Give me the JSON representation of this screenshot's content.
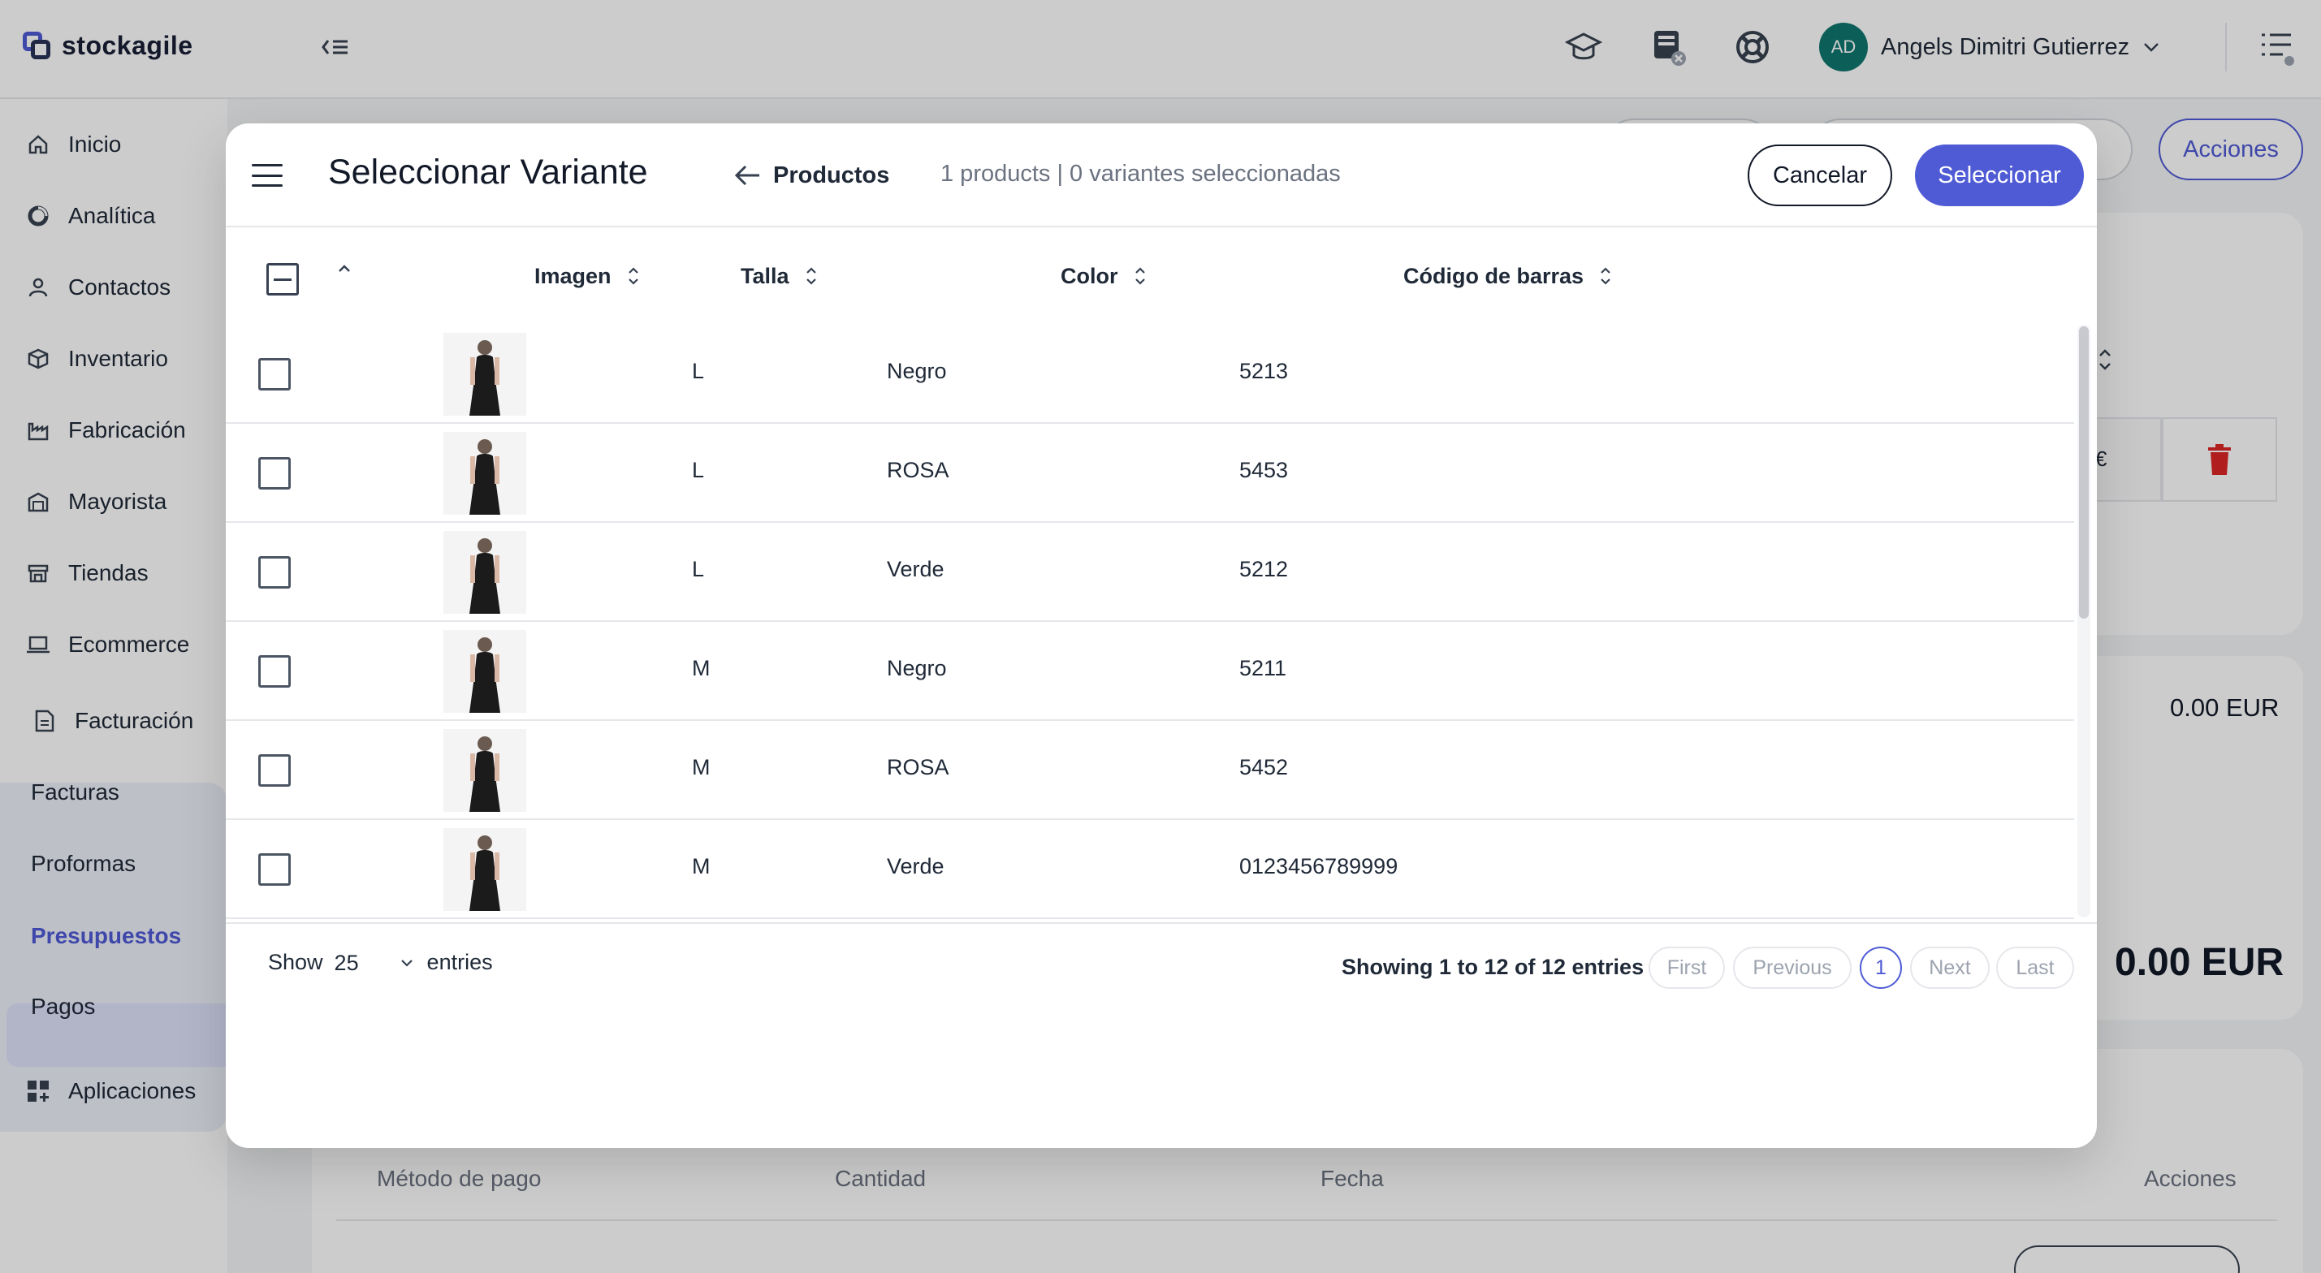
{
  "app": {
    "logo_text": "stockagile",
    "user_initials": "AD",
    "user_name": "Angels Dimitri Gutierrez",
    "accent_color": "#4f5bd5"
  },
  "sidebar": {
    "items": [
      {
        "label": "Inicio",
        "icon": "home-icon"
      },
      {
        "label": "Analítica",
        "icon": "analytics-icon"
      },
      {
        "label": "Contactos",
        "icon": "user-icon"
      },
      {
        "label": "Inventario",
        "icon": "box-icon"
      },
      {
        "label": "Fabricación",
        "icon": "factory-icon"
      },
      {
        "label": "Mayorista",
        "icon": "warehouse-icon"
      },
      {
        "label": "Tiendas",
        "icon": "store-icon"
      },
      {
        "label": "Ecommerce",
        "icon": "laptop-icon"
      },
      {
        "label": "Facturación",
        "icon": "invoice-icon"
      },
      {
        "label": "Aplicaciones",
        "icon": "apps-icon"
      }
    ],
    "facturacion_sub": [
      "Facturas",
      "Proformas",
      "Presupuestos",
      "Pagos"
    ],
    "active_sub": "Presupuestos"
  },
  "background": {
    "acciones_label": "Acciones",
    "total_small": "0.00 EUR",
    "total_large": "0.00 EUR",
    "euro_sign": "€",
    "payments_headers": [
      "Método de pago",
      "Cantidad",
      "Fecha",
      "Acciones"
    ]
  },
  "modal": {
    "title": "Seleccionar Variante",
    "back_label": "Productos",
    "selection_info": "1 products | 0 variantes seleccionadas",
    "cancel_label": "Cancelar",
    "select_label": "Seleccionar",
    "columns": {
      "image": "Imagen",
      "size": "Talla",
      "color": "Color",
      "barcode": "Código de barras"
    },
    "rows": [
      {
        "size": "L",
        "color": "Negro",
        "barcode": "5213"
      },
      {
        "size": "L",
        "color": "ROSA",
        "barcode": "5453"
      },
      {
        "size": "L",
        "color": "Verde",
        "barcode": "5212"
      },
      {
        "size": "M",
        "color": "Negro",
        "barcode": "5211"
      },
      {
        "size": "M",
        "color": "ROSA",
        "barcode": "5452"
      },
      {
        "size": "M",
        "color": "Verde",
        "barcode": "0123456789999"
      }
    ],
    "footer": {
      "show_label": "Show",
      "show_value": "25",
      "entries_label": "entries",
      "showing_text": "Showing 1 to 12 of 12 entries",
      "pager": {
        "first": "First",
        "previous": "Previous",
        "current": "1",
        "next": "Next",
        "last": "Last"
      }
    }
  }
}
